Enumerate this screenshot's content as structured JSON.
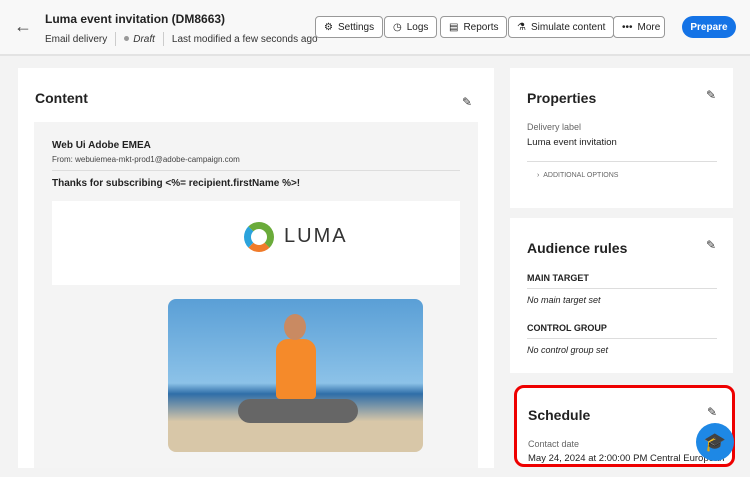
{
  "header": {
    "title": "Luma event invitation (DM8663)",
    "type": "Email delivery",
    "status": "Draft",
    "modified": "Last modified a few seconds ago",
    "buttons": {
      "settings": "Settings",
      "logs": "Logs",
      "reports": "Reports",
      "simulate": "Simulate content",
      "more": "More",
      "prepare": "Prepare"
    }
  },
  "content": {
    "title": "Content",
    "sender": "Web Ui Adobe EMEA",
    "from": "From: webuiemea-mkt-prod1@adobe-campaign.com",
    "subject": "Thanks for subscribing <%= recipient.firstName %>!",
    "logo": "LUMA"
  },
  "properties": {
    "title": "Properties",
    "label_caption": "Delivery label",
    "label_value": "Luma event invitation",
    "additional": "ADDITIONAL OPTIONS"
  },
  "audience": {
    "title": "Audience rules",
    "main_target": "MAIN TARGET",
    "main_value": "No main target set",
    "control": "CONTROL GROUP",
    "control_value": "No control group set"
  },
  "schedule": {
    "title": "Schedule",
    "caption": "Contact date",
    "value": "May 24, 2024 at 2:00:00 PM Central European"
  }
}
